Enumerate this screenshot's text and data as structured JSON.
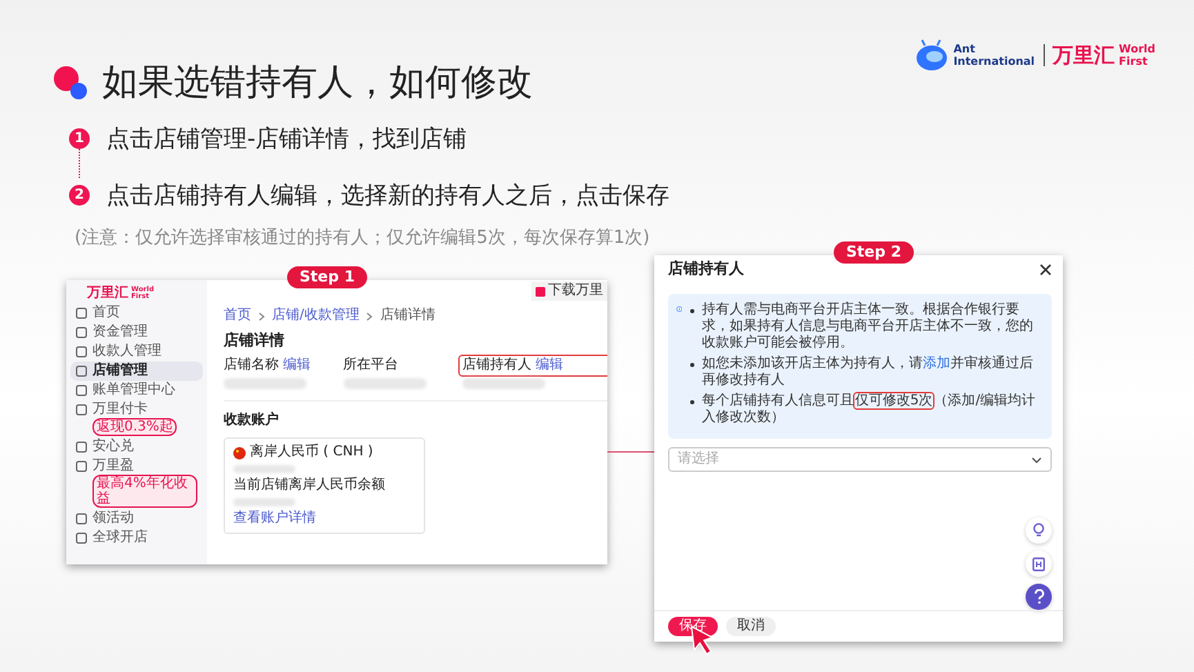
{
  "slide": {
    "title": "如果选错持有人，如何修改",
    "steps": [
      {
        "number": "1",
        "text": "点击店铺管理-店铺详情，找到店铺"
      },
      {
        "number": "2",
        "text": "点击店铺持有人编辑，选择新的持有人之后，点击保存"
      }
    ],
    "note": "(注意：仅允许选择审核通过的持有人；仅允许编辑5次，每次保存算1次)"
  },
  "logo": {
    "ant_line1": "Ant",
    "ant_line2": "International",
    "wf_cn": "万里汇",
    "wf_line1": "World",
    "wf_line2": "First"
  },
  "step1": {
    "badge": "Step 1",
    "logo_cn": "万里汇",
    "logo_line1": "World",
    "logo_line2": "First",
    "download": "下载万里",
    "sidebar": [
      {
        "label": "首页",
        "selected": false
      },
      {
        "label": "资金管理",
        "selected": false
      },
      {
        "label": "收款人管理",
        "selected": false
      },
      {
        "label": "店铺管理",
        "selected": true
      },
      {
        "label": "账单管理中心",
        "selected": false
      },
      {
        "label": "万里付卡",
        "selected": false,
        "tag": "返现0.3%起"
      },
      {
        "label": "安心兑",
        "selected": false
      },
      {
        "label": "万里盈",
        "selected": false,
        "tag": "最高4%年化收益"
      },
      {
        "label": "领活动",
        "selected": false
      },
      {
        "label": "全球开店",
        "selected": false
      }
    ],
    "breadcrumb": [
      "首页",
      "店铺/收款管理",
      "店铺详情"
    ],
    "page_title": "店铺详情",
    "fields": [
      {
        "label": "店铺名称",
        "action": "编辑",
        "highlighted": false
      },
      {
        "label": "所在平台",
        "highlighted": false
      },
      {
        "label": "店铺持有人",
        "action": "编辑",
        "highlighted": true
      }
    ],
    "section_title": "收款账户",
    "account_card": {
      "currency": "离岸人民币 ( CNH )",
      "balance_label": "当前店铺离岸人民币余额",
      "link": "查看账户详情"
    }
  },
  "step2": {
    "badge": "Step 2",
    "title": "店铺持有人",
    "bullets": [
      [
        {
          "kind": "plain",
          "text": "持有人需与电商平台开店主体一致。根据合作银行要求，如果持有人信息与电商平台开店主体不一致，您的收款账户可能会被停用。"
        }
      ],
      [
        {
          "kind": "plain",
          "text": "如您未添加该开店主体为持有人，请"
        },
        {
          "kind": "link",
          "text": "添加"
        },
        {
          "kind": "plain",
          "text": "并审核通过后再修改持有人"
        }
      ],
      [
        {
          "kind": "plain",
          "text": "每个店铺持有人信息可且"
        },
        {
          "kind": "highlight",
          "text": "仅可修改5次"
        },
        {
          "kind": "plain",
          "text": "（添加/编辑均计入修改次数）"
        }
      ]
    ],
    "select_placeholder": "请选择",
    "buttons": [
      {
        "kind": "primary",
        "label": "保存"
      },
      {
        "kind": "secondary",
        "label": "取消"
      }
    ]
  }
}
